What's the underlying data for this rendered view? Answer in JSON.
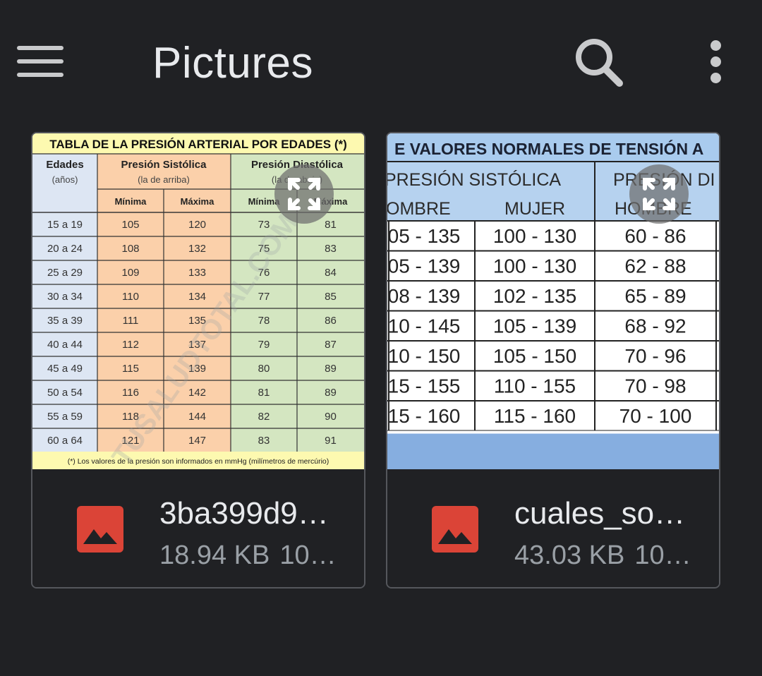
{
  "appbar": {
    "title": "Pictures",
    "menu_icon": "hamburger-menu-icon",
    "search_icon": "search-icon",
    "more_icon": "more-vert-icon"
  },
  "files": [
    {
      "name": "3ba399d9…",
      "size": "18.94 KB",
      "date": "10…",
      "thumbnail": {
        "title": "TABLA DE LA PRESIÓN ARTERIAL POR EDADES (*)",
        "col_ages": "Edades",
        "col_ages_sub": "(años)",
        "col_sys": "Presión Sistólica",
        "col_sys_sub": "(la de arriba)",
        "col_dia": "Presión Diastólica",
        "col_dia_sub": "(la de abajo)",
        "min_label": "Mínima",
        "max_label": "Máxima",
        "rows": [
          [
            "15 a 19",
            "105",
            "120",
            "73",
            "81"
          ],
          [
            "20 a 24",
            "108",
            "132",
            "75",
            "83"
          ],
          [
            "25 a 29",
            "109",
            "133",
            "76",
            "84"
          ],
          [
            "30 a 34",
            "110",
            "134",
            "77",
            "85"
          ],
          [
            "35 a 39",
            "111",
            "135",
            "78",
            "86"
          ],
          [
            "40 a 44",
            "112",
            "137",
            "79",
            "87"
          ],
          [
            "45 a 49",
            "115",
            "139",
            "80",
            "89"
          ],
          [
            "50 a 54",
            "116",
            "142",
            "81",
            "89"
          ],
          [
            "55 a 59",
            "118",
            "144",
            "82",
            "90"
          ],
          [
            "60 a 64",
            "121",
            "147",
            "83",
            "91"
          ]
        ],
        "footnote": "(*) Los valores de la presión son informados  en mmHg (milímetros de mercúrio)",
        "watermark": "TUSALUDTOTAL.COM"
      }
    },
    {
      "name": "cuales_so…",
      "size": "43.03 KB",
      "date": "10…",
      "thumbnail": {
        "title": "E VALORES NORMALES DE TENSIÓN A",
        "col_sys": "PRESIÓN SISTÓLICA",
        "col_dia": "PRESIÓN DI",
        "hombre": "OMBRE",
        "mujer": "MUJER",
        "hombre2": "HOMBRE",
        "rows": [
          [
            "05 - 135",
            "100 - 130",
            "60 - 86"
          ],
          [
            "05 - 139",
            "100 - 130",
            "62 - 88"
          ],
          [
            "08 - 139",
            "102 - 135",
            "65 - 89"
          ],
          [
            "10 - 145",
            "105 - 139",
            "68 - 92"
          ],
          [
            "10 - 150",
            "105 - 150",
            "70 - 96"
          ],
          [
            "15 - 155",
            "110 - 155",
            "70 - 98"
          ],
          [
            "15 - 160",
            "115 - 160",
            "70 - 100"
          ]
        ]
      }
    }
  ],
  "colors": {
    "background": "#202124",
    "card_border": "#55575c",
    "image_icon_red": "#db4437",
    "table1_title_bg": "#fdf9b0",
    "table1_age_bg": "#dde6f3",
    "table1_sys_bg": "#fbd0aa",
    "table1_dia_bg": "#d4e6c1",
    "table2_header_bg": "#b6d2ef",
    "table2_footer_bg": "#86aee0"
  }
}
